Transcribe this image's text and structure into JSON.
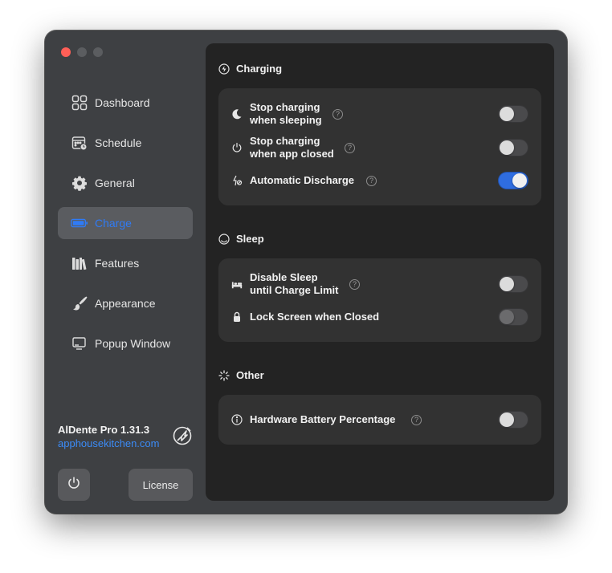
{
  "sidebar": {
    "items": [
      {
        "label": "Dashboard",
        "icon": "dashboard-icon"
      },
      {
        "label": "Schedule",
        "icon": "calendar-icon"
      },
      {
        "label": "General",
        "icon": "gear-icon"
      },
      {
        "label": "Charge",
        "icon": "battery-icon",
        "active": true
      },
      {
        "label": "Features",
        "icon": "books-icon"
      },
      {
        "label": "Appearance",
        "icon": "paintbrush-icon"
      },
      {
        "label": "Popup Window",
        "icon": "monitor-icon"
      }
    ],
    "app_name": "AlDente Pro 1.31.3",
    "app_link": "apphousekitchen.com",
    "license_label": "License"
  },
  "main": {
    "charging": {
      "title": "Charging",
      "rows": [
        {
          "label_line1": "Stop charging",
          "label_line2": "when sleeping",
          "on": false
        },
        {
          "label_line1": "Stop charging",
          "label_line2": "when app closed",
          "on": false
        },
        {
          "label": "Automatic Discharge",
          "on": true
        }
      ]
    },
    "sleep": {
      "title": "Sleep",
      "rows": [
        {
          "label_line1": "Disable Sleep",
          "label_line2": "until Charge Limit",
          "on": false
        },
        {
          "label": "Lock Screen when Closed",
          "on": false,
          "disabled": true
        }
      ]
    },
    "other": {
      "title": "Other",
      "rows": [
        {
          "label": "Hardware Battery Percentage",
          "on": false
        }
      ]
    }
  },
  "colors": {
    "accent": "#2f7bf6",
    "link": "#3b8bf7",
    "toggle_on": "#2f6de0",
    "close": "#ff5f57"
  }
}
